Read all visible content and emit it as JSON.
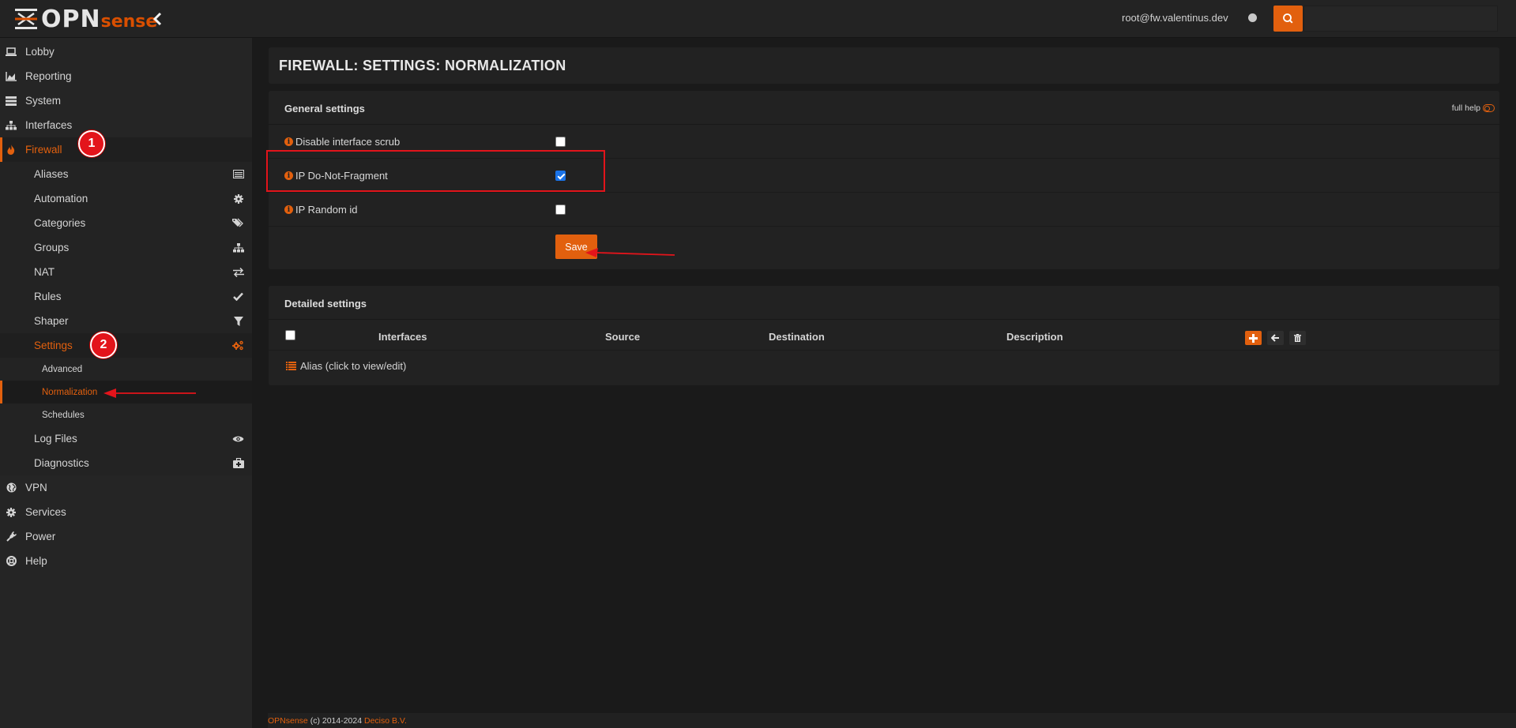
{
  "brand": {
    "opn": "OPN",
    "sense": "sense"
  },
  "header": {
    "user": "root@fw.valentinus.dev",
    "search_placeholder": ""
  },
  "sidebar": {
    "items": [
      {
        "label": "Lobby",
        "icon": "laptop-icon"
      },
      {
        "label": "Reporting",
        "icon": "area-chart-icon"
      },
      {
        "label": "System",
        "icon": "server-icon"
      },
      {
        "label": "Interfaces",
        "icon": "sitemap-icon"
      },
      {
        "label": "Firewall",
        "icon": "fire-icon"
      }
    ],
    "firewall_sub": [
      {
        "label": "Aliases",
        "icon": "list-alt-icon"
      },
      {
        "label": "Automation",
        "icon": "cog-icon"
      },
      {
        "label": "Categories",
        "icon": "tags-icon"
      },
      {
        "label": "Groups",
        "icon": "sitemap-icon"
      },
      {
        "label": "NAT",
        "icon": "exchange-icon"
      },
      {
        "label": "Rules",
        "icon": "check-icon"
      },
      {
        "label": "Shaper",
        "icon": "filter-icon"
      },
      {
        "label": "Settings",
        "icon": "cogs-icon"
      }
    ],
    "settings_sub": [
      "Advanced",
      "Normalization",
      "Schedules"
    ],
    "firewall_sub2": [
      {
        "label": "Log Files",
        "icon": "eye-icon"
      },
      {
        "label": "Diagnostics",
        "icon": "medkit-icon"
      }
    ],
    "items2": [
      {
        "label": "VPN",
        "icon": "globe-icon"
      },
      {
        "label": "Services",
        "icon": "cog-icon"
      },
      {
        "label": "Power",
        "icon": "plug-icon"
      },
      {
        "label": "Help",
        "icon": "life-ring-icon"
      }
    ]
  },
  "annotations": {
    "badge1": "1",
    "badge2": "2"
  },
  "page": {
    "title": "FIREWALL: SETTINGS: NORMALIZATION"
  },
  "general": {
    "title": "General settings",
    "full_help": "full help",
    "fields": [
      {
        "label": "Disable interface scrub",
        "checked": false
      },
      {
        "label": "IP Do-Not-Fragment",
        "checked": true
      },
      {
        "label": "IP Random id",
        "checked": false
      }
    ],
    "save_label": "Save"
  },
  "detailed": {
    "title": "Detailed settings",
    "columns": [
      "Interfaces",
      "Source",
      "Destination",
      "Description"
    ],
    "alias_text": "Alias (click to view/edit)"
  },
  "footer": {
    "brand": "OPNsense",
    "copy": " (c) 2014-2024 ",
    "company": "Deciso B.V."
  },
  "colors": {
    "accent": "#e2600e",
    "annotation_red": "#e3141b"
  }
}
